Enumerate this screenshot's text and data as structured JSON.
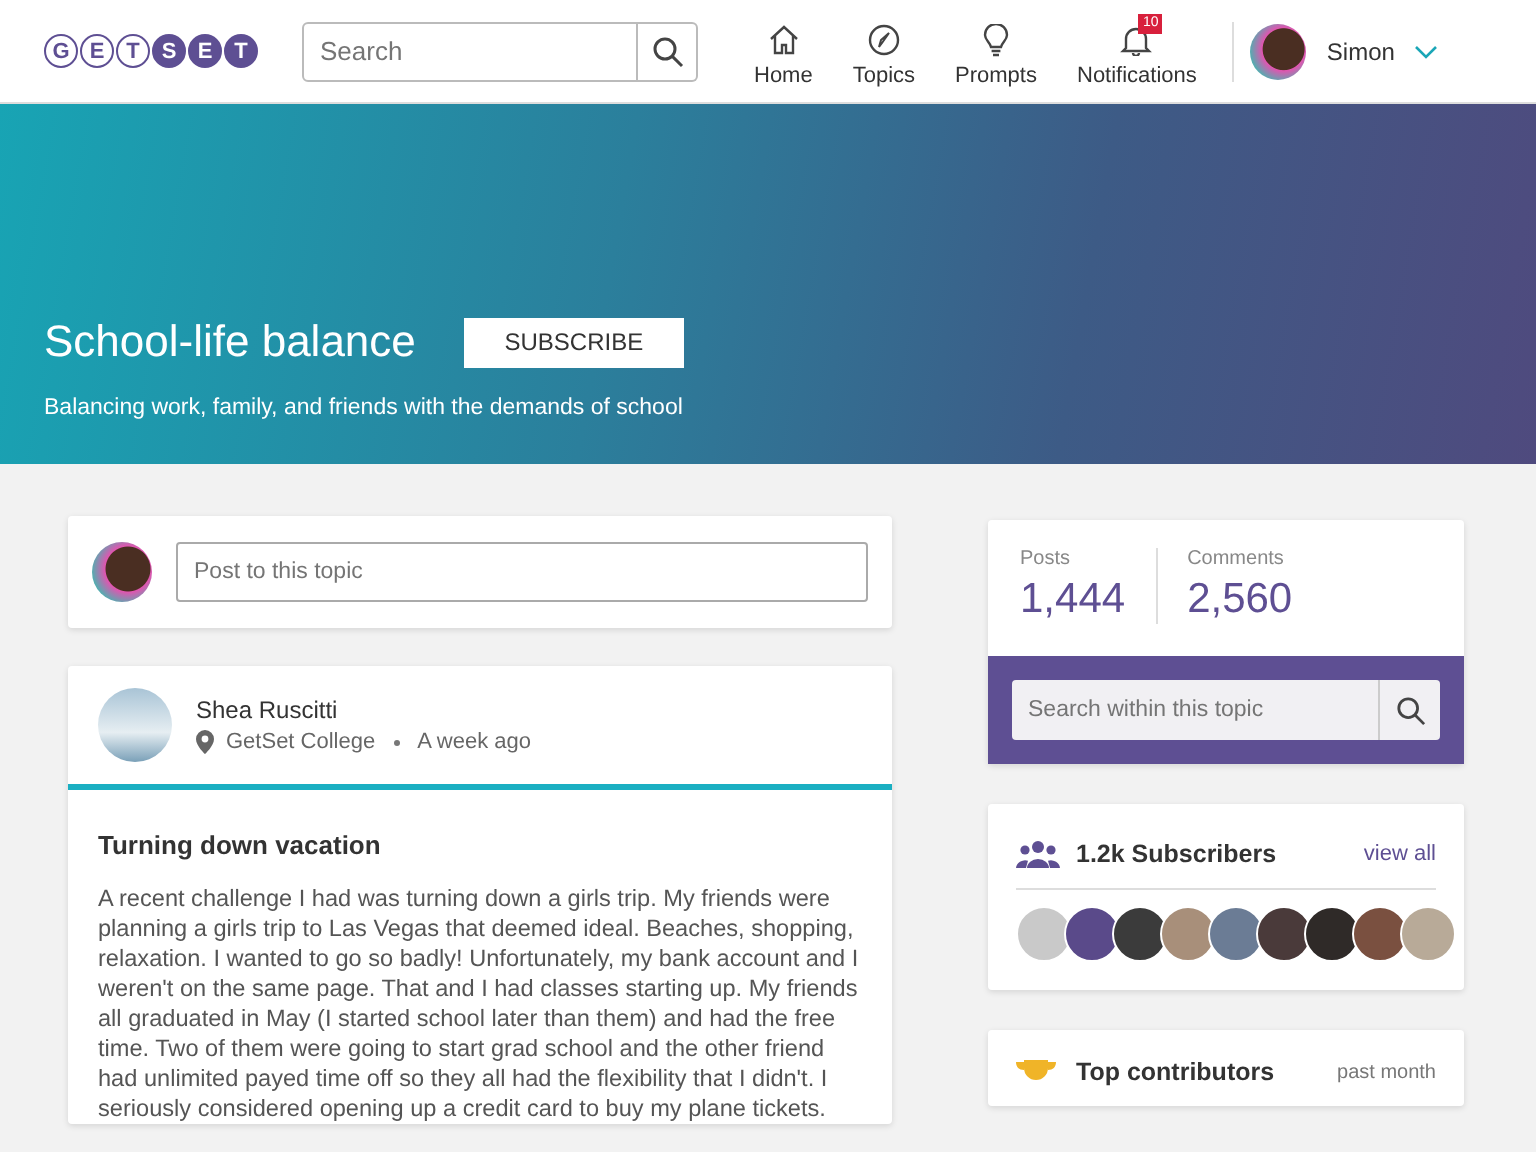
{
  "logo": {
    "letters": [
      {
        "char": "G",
        "filled": false
      },
      {
        "char": "E",
        "filled": false
      },
      {
        "char": "T",
        "filled": false
      },
      {
        "char": "S",
        "filled": true
      },
      {
        "char": "E",
        "filled": true
      },
      {
        "char": "T",
        "filled": true
      }
    ]
  },
  "search": {
    "placeholder": "Search"
  },
  "nav": [
    {
      "kind": "home",
      "label": "Home"
    },
    {
      "kind": "topics",
      "label": "Topics"
    },
    {
      "kind": "prompts",
      "label": "Prompts"
    },
    {
      "kind": "notifications",
      "label": "Notifications",
      "badge": "10"
    }
  ],
  "user": {
    "name": "Simon"
  },
  "topic": {
    "title": "School-life balance",
    "subscribe": "SUBSCRIBE",
    "description": "Balancing work, family, and friends with the demands of school"
  },
  "composer": {
    "placeholder": "Post to this topic"
  },
  "post": {
    "author": "Shea Ruscitti",
    "location": "GetSet College",
    "time": "A week ago",
    "title": "Turning down vacation",
    "body": "A recent challenge I had was turning down a girls trip. My friends were planning a girls trip to Las Vegas that deemed ideal. Beaches, shopping, relaxation. I wanted to go so badly! Unfortunately, my bank account and I weren't on the same page. That and I had classes starting up. My friends all graduated in May (I started school later than them) and had the free time. Two of them were going to start grad school and the other friend had unlimited payed time off so they all had the flexibility that I didn't. I seriously considered opening up a credit card to buy my plane tickets."
  },
  "stats": [
    {
      "label": "Posts",
      "value": "1,444"
    },
    {
      "label": "Comments",
      "value": "2,560"
    }
  ],
  "topic_search": {
    "placeholder": "Search within this topic"
  },
  "subscribers": {
    "title": "1.2k Subscribers",
    "link": "view all"
  },
  "contributors": {
    "title": "Top contributors",
    "period": "past month"
  }
}
